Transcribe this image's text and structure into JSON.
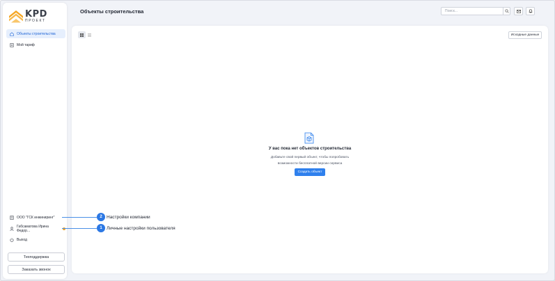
{
  "app": {
    "logo_main": "KPD",
    "logo_sub": "ПРОЕКТ",
    "accent_color": "#2f80ed",
    "logo_color": "#f5a623"
  },
  "sidebar": {
    "items": [
      {
        "label": "Объекты строительства",
        "icon": "home-icon",
        "active": true
      },
      {
        "label": "Мой тариф",
        "icon": "document-icon",
        "active": false
      }
    ],
    "company": {
      "label": "ООО \"ГСК инжиниринг\"",
      "icon": "building-icon"
    },
    "user": {
      "label": "Габсаматова Ирина Федор...",
      "icon": "user-icon",
      "has_notification": true
    },
    "logout": {
      "label": "Выход",
      "icon": "power-icon"
    },
    "support_button": "Техподдержка",
    "callback_button": "Заказать звонок"
  },
  "header": {
    "title": "Объекты строительства",
    "search_placeholder": "Поиск..."
  },
  "main": {
    "source_data_button": "Исходные данные",
    "empty_state": {
      "title": "У вас пока нет объектов строительства",
      "description_line1": "Добавьте свой первый объект, чтобы попробовать",
      "description_line2": "возможности бесплатной версии сервиса",
      "create_button": "Создать объект"
    }
  },
  "callouts": [
    {
      "number": "2",
      "label": "Настройки компании"
    },
    {
      "number": "1",
      "label": "Личные настройки пользователя"
    }
  ]
}
